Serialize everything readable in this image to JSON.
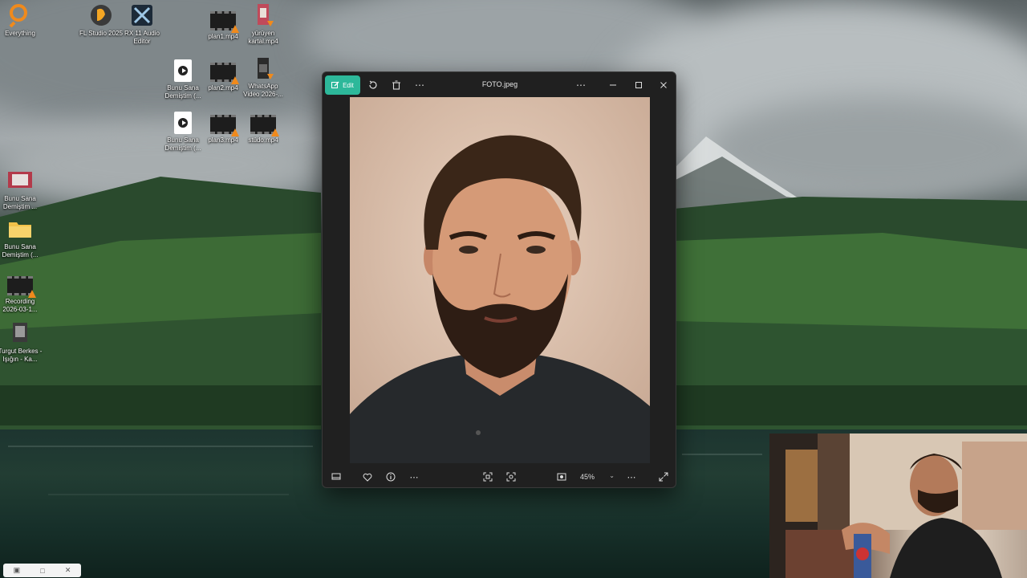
{
  "desktop": {
    "icons": [
      {
        "label": "Everything",
        "icon": "everything-search-icon"
      },
      {
        "label": "FL Studio 2025",
        "icon": "fl-studio-icon"
      },
      {
        "label": "RX 11 Audio Editor",
        "icon": "rx-audio-editor-icon"
      },
      {
        "label": "plan1.mp4",
        "icon": "video-file-icon"
      },
      {
        "label": "yürüyen kartal.mp4",
        "icon": "video-file-icon"
      },
      {
        "label": "Bunu Sana Demiştim (...",
        "icon": "media-shortcut-icon"
      },
      {
        "label": "plan2.mp4",
        "icon": "video-file-icon"
      },
      {
        "label": "WhatsApp Video 2026-...",
        "icon": "video-file-icon"
      },
      {
        "label": "Bunu Sana Demiştim (...",
        "icon": "media-shortcut-icon"
      },
      {
        "label": "plan3.mp4",
        "icon": "video-file-icon"
      },
      {
        "label": "stüdo.mp4",
        "icon": "video-file-icon"
      },
      {
        "label": "Bunu Sana Demiştim ...",
        "icon": "image-file-icon"
      },
      {
        "label": "Bunu Sana Demiştim (...",
        "icon": "folder-icon"
      },
      {
        "label": "Recording 2026-03-1...",
        "icon": "video-file-icon"
      },
      {
        "label": "Turgut Berkes - Işığın - Ka...",
        "icon": "audio-file-icon"
      }
    ]
  },
  "photos": {
    "title": "FOTO.jpeg",
    "edit_label": "Edit",
    "zoom": "45%",
    "zoom_value_percent": 45,
    "toolbar_icons": [
      "edit-icon",
      "rotate-icon",
      "delete-icon",
      "more-icon"
    ],
    "bottom_icons": [
      "filmstrip-icon",
      "favorite-icon",
      "info-icon",
      "more-icon",
      "fit-icon",
      "actual-size-icon",
      "screenshot-icon",
      "more-icon",
      "fullscreen-icon"
    ]
  },
  "colors": {
    "edit_accent": "#2db89a",
    "window_bg": "#202020"
  }
}
